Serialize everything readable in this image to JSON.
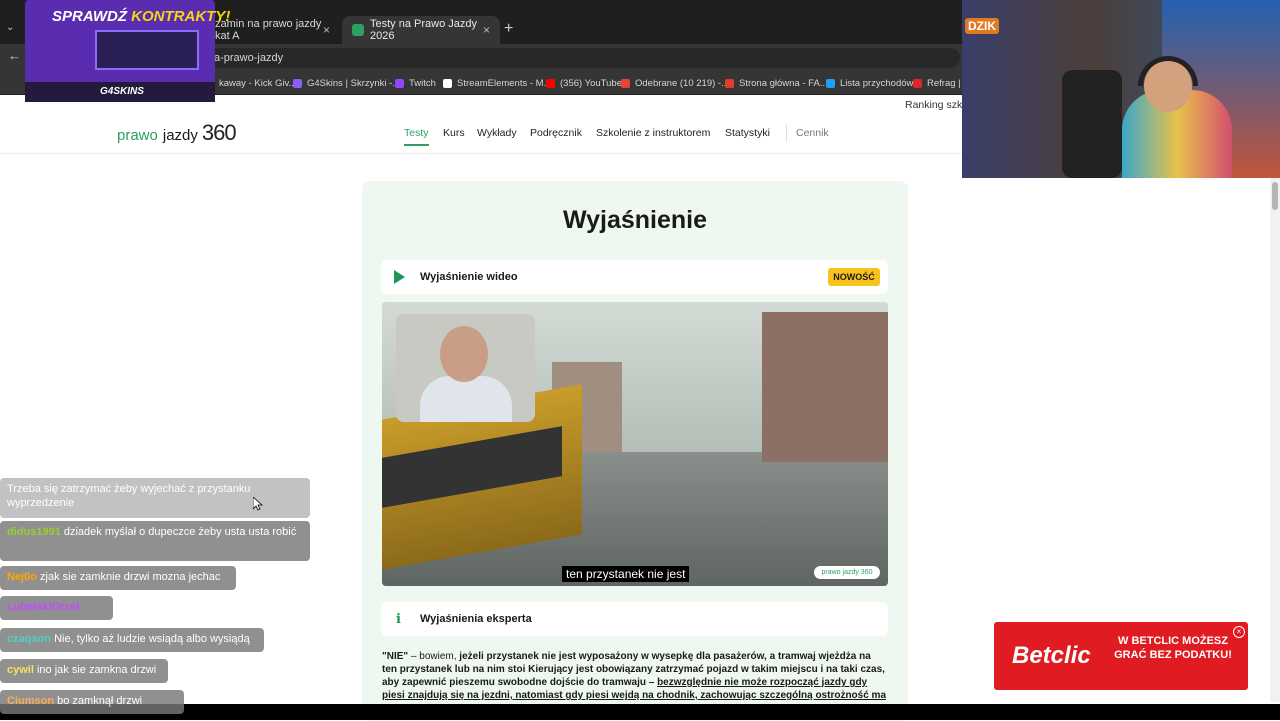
{
  "browser": {
    "tabs": [
      {
        "label": "zamin na prawo jazdy kat A",
        "active": false
      },
      {
        "label": "Testy na Prawo Jazdy 2026",
        "active": true
      }
    ],
    "new_tab": "+",
    "close": "×",
    "url": "a-prawo-jazdy",
    "bookmarks": [
      {
        "label": "kaway - Kick Giv...",
        "color": "#53fc18"
      },
      {
        "label": "G4Skins | Skrzynki -...",
        "color": "#8b5cf6"
      },
      {
        "label": "Twitch",
        "color": "#9146ff"
      },
      {
        "label": "StreamElements - M...",
        "color": "#ffffff"
      },
      {
        "label": "(356) YouTube",
        "color": "#ff0000"
      },
      {
        "label": "Odebrane (10 219) -...",
        "color": "#ea4335"
      },
      {
        "label": "Strona główna - FA...",
        "color": "#e03d2f"
      },
      {
        "label": "Lista przychodów",
        "color": "#1da1f2"
      },
      {
        "label": "Refrag | D",
        "color": "#e0242b"
      }
    ]
  },
  "site": {
    "ranking": "Ranking szk",
    "logo": {
      "prawo": "prawo",
      "jazdy": "jazdy",
      "num": "360"
    },
    "nav": [
      "Testy",
      "Kurs",
      "Wykłady",
      "Podręcznik",
      "Szkolenie z instruktorem",
      "Statystyki",
      "Cennik"
    ],
    "heading": "Wyjaśnienie",
    "video_title": "Wyjaśnienie wideo",
    "badge": "NOWOŚĆ",
    "video_caption": "ten przystanek nie jest",
    "video_logo": "prawo jazdy 360",
    "expert_title": "Wyjaśnienia eksperta",
    "expert": {
      "part1": "\"NIE\"",
      "part2": " – bowiem, ",
      "part3": "jeżeli przystanek nie jest wyposażony w wysepkę dla pasażerów, a tramwaj wjeżdża na ten przystanek lub na nim stoi Kierujący jest obowiązany zatrzymać pojazd w takim miejscu i na taki czas, aby zapewnić pieszemu swobodne dojście do tramwaju",
      "part4": " – ",
      "part5": "bezwzględnie nie może rozpocząć jazdy gdy piesi znajdują się na jezdni, natomiast gdy piesi wejdą na chodnik, zachowując szczególną ostrożność ma"
    }
  },
  "overlay": {
    "promo_title_a": "SPRAWDŹ ",
    "promo_title_b": "KONTRAKTY!",
    "promo_brand": "G4SKINS",
    "webcam_sign": "DZIK",
    "betclic_logo": "Betclic",
    "betclic_text": "W BETCLIC MOŻESZ GRAĆ BEZ PODATKU!",
    "betclic_close": "×"
  },
  "chat": [
    {
      "user": "",
      "user_color": "#ffffff",
      "text": "Trzeba się zatrzymać żeby wyjechać z przystanku wyprzedzenie"
    },
    {
      "user": "didus1991",
      "user_color": "#9acd32",
      "text": "dziadek myślał o dupeczce żeby usta usta robić"
    },
    {
      "user": "Nej0o",
      "user_color": "#ffa500",
      "text": "zjak sie zamknie drzwi mozna jechac"
    },
    {
      "user": "LubelskiOrzeł",
      "user_color": "#c34bff",
      "text": ""
    },
    {
      "user": "czaqson",
      "user_color": "#4fd1c5",
      "text": "Nie, tylko aż ludzie wsiądą albo wysiądą"
    },
    {
      "user": "cywil",
      "user_color": "#f6e05e",
      "text": "ino jak sie zamkna drzwi"
    },
    {
      "user": "Ciumson",
      "user_color": "#f6ad55",
      "text": "bo zamknął drzwi"
    }
  ]
}
